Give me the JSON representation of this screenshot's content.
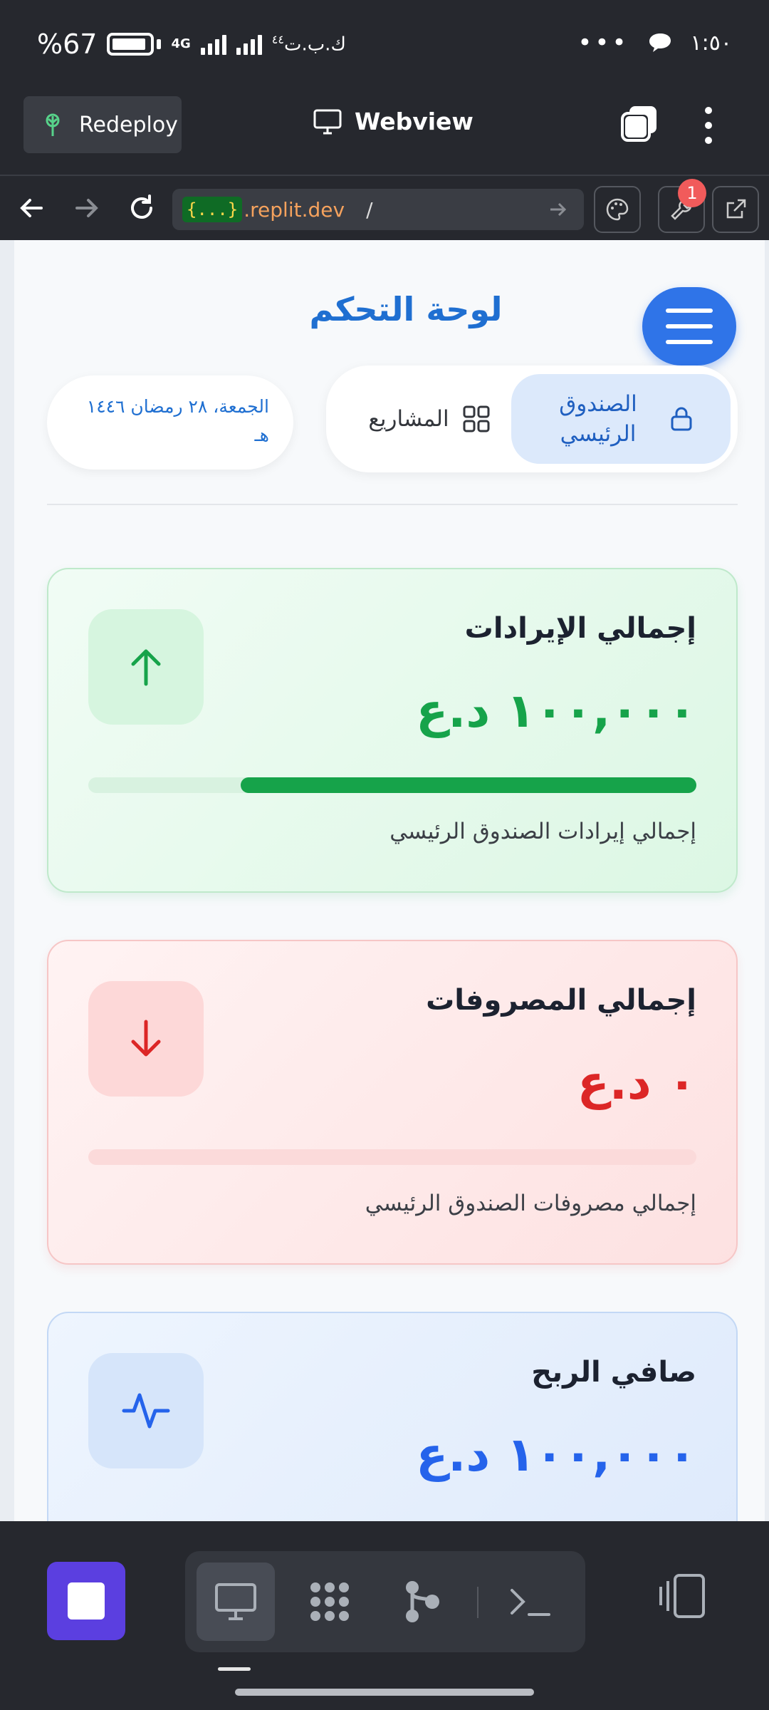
{
  "status_bar": {
    "battery_percent": "%67",
    "network": "4G",
    "carrier": "ك.ب.ت",
    "carrier_sup": "٤٤",
    "time": "١:٥٠"
  },
  "app_bar": {
    "redeploy_label": "Redeploy",
    "webview_label": "Webview"
  },
  "url_bar": {
    "tag": "{...}",
    "host": ".replit.dev",
    "path": "/",
    "notifications_count": "1"
  },
  "page": {
    "title": "لوحة التحكم",
    "date": "الجمعة، ٢٨ رمضان ١٤٤٦ هـ",
    "tabs": [
      {
        "label": "الصندوق الرئيسي",
        "active": true,
        "icon": "lock-icon"
      },
      {
        "label": "المشاريع",
        "active": false,
        "icon": "grid-icon"
      }
    ]
  },
  "cards": {
    "revenue": {
      "title": "إجمالي الإيرادات",
      "value": "١٠٠,٠٠٠ د.ع",
      "note": "إجمالي إيرادات الصندوق الرئيسي",
      "progress": 0.75,
      "icon": "arrow-up-icon",
      "color": "#16a34a"
    },
    "expenses": {
      "title": "إجمالي المصروفات",
      "value": "٠ د.ع",
      "note": "إجمالي مصروفات الصندوق الرئيسي",
      "progress": 0,
      "icon": "arrow-down-icon",
      "color": "#dc2626"
    },
    "profit": {
      "title": "صافي الربح",
      "value": "١٠٠,٠٠٠ د.ع",
      "icon": "activity-icon",
      "color": "#2563eb"
    }
  },
  "colors": {
    "accent": "#2f74e8",
    "title_blue": "#1f6fd1",
    "stop_button": "#5b3fe0"
  }
}
